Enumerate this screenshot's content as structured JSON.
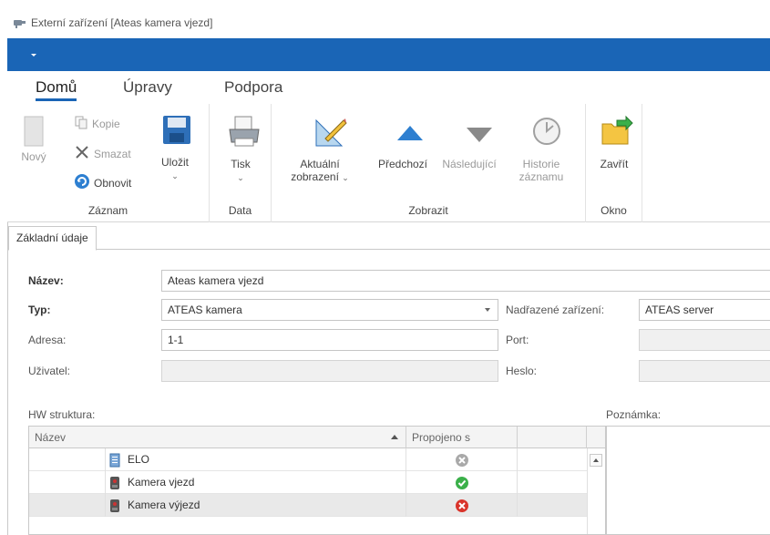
{
  "window": {
    "title": "Externí zařízení [Ateas kamera vjezd]",
    "app_icon": "camera-icon"
  },
  "ribbon_tabs": [
    {
      "label": "Domů",
      "active": true
    },
    {
      "label": "Úpravy",
      "active": false
    },
    {
      "label": "Podpora",
      "active": false
    }
  ],
  "ribbon": {
    "zaznam": {
      "label": "Záznam",
      "new": "Nový",
      "copy": "Kopie",
      "delete": "Smazat",
      "refresh": "Obnovit",
      "save": "Uložit"
    },
    "data": {
      "label": "Data",
      "print": "Tisk"
    },
    "zobrazit": {
      "label": "Zobrazit",
      "current_view_line1": "Aktuální",
      "current_view_line2": "zobrazení",
      "previous": "Předchozí",
      "next": "Následující",
      "history_line1": "Historie",
      "history_line2": "záznamu"
    },
    "okno": {
      "label": "Okno",
      "close": "Zavřít"
    }
  },
  "doc_tab": "Základní údaje",
  "form": {
    "name_label": "Název:",
    "name_value": "Ateas kamera vjezd",
    "type_label": "Typ:",
    "type_value": "ATEAS kamera",
    "parent_label": "Nadřazené zařízení:",
    "parent_value": "ATEAS server",
    "address_label": "Adresa:",
    "address_value": "1-1",
    "port_label": "Port:",
    "port_value": "",
    "user_label": "Uživatel:",
    "user_value": "",
    "password_label": "Heslo:",
    "password_value": ""
  },
  "hw": {
    "label": "HW struktura:",
    "col_name": "Název",
    "col_link": "Propojeno s",
    "rows": [
      {
        "name": "ELO",
        "status": "disabled",
        "icon": "controller-icon"
      },
      {
        "name": "Kamera vjezd",
        "status": "ok",
        "icon": "camera-device-icon"
      },
      {
        "name": "Kamera výjezd",
        "status": "error",
        "icon": "camera-device-icon"
      }
    ]
  },
  "notes": {
    "label": "Poznámka:"
  },
  "colors": {
    "accent": "#1a65b6",
    "ok": "#3bb04a",
    "error": "#d9342b",
    "disabled": "#a9a9a9"
  }
}
